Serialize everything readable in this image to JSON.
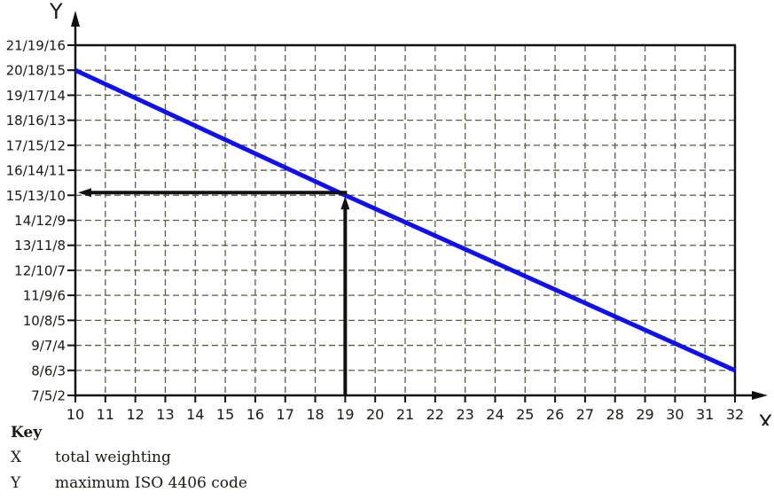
{
  "chart_data": {
    "type": "line",
    "title": "",
    "xlabel": "X",
    "ylabel": "Y",
    "x_ticks": [
      10,
      11,
      12,
      13,
      14,
      15,
      16,
      17,
      18,
      19,
      20,
      21,
      22,
      23,
      24,
      25,
      26,
      27,
      28,
      29,
      30,
      31,
      32
    ],
    "xlim": [
      10,
      32
    ],
    "y_tick_labels": [
      "7/5/2",
      "8/6/3",
      "9/7/4",
      "10/8/5",
      "11/9/6",
      "12/10/7",
      "13/11/8",
      "14/12/9",
      "15/13/10",
      "16/14/11",
      "17/15/12",
      "18/16/13",
      "19/17/14",
      "20/18/15",
      "21/19/16"
    ],
    "ylim_index": [
      0,
      14
    ],
    "grid": true,
    "series": [
      {
        "name": "maximum ISO 4406 code",
        "color": "#1010ee",
        "x": [
          10,
          19,
          32
        ],
        "y_index": [
          13,
          8,
          1
        ],
        "y_labels": [
          "20/18/15",
          "15/13/10",
          "8/6/3"
        ]
      }
    ],
    "annotations": [
      {
        "type": "lookup-arrows",
        "color": "#111111",
        "from_x": 19,
        "to_y_label": "15/13/10",
        "to_y_index": 8
      }
    ]
  },
  "key": {
    "title": "Key",
    "items": [
      {
        "symbol": "X",
        "label": "total weighting"
      },
      {
        "symbol": "Y",
        "label": "maximum ISO 4406 code"
      }
    ]
  }
}
